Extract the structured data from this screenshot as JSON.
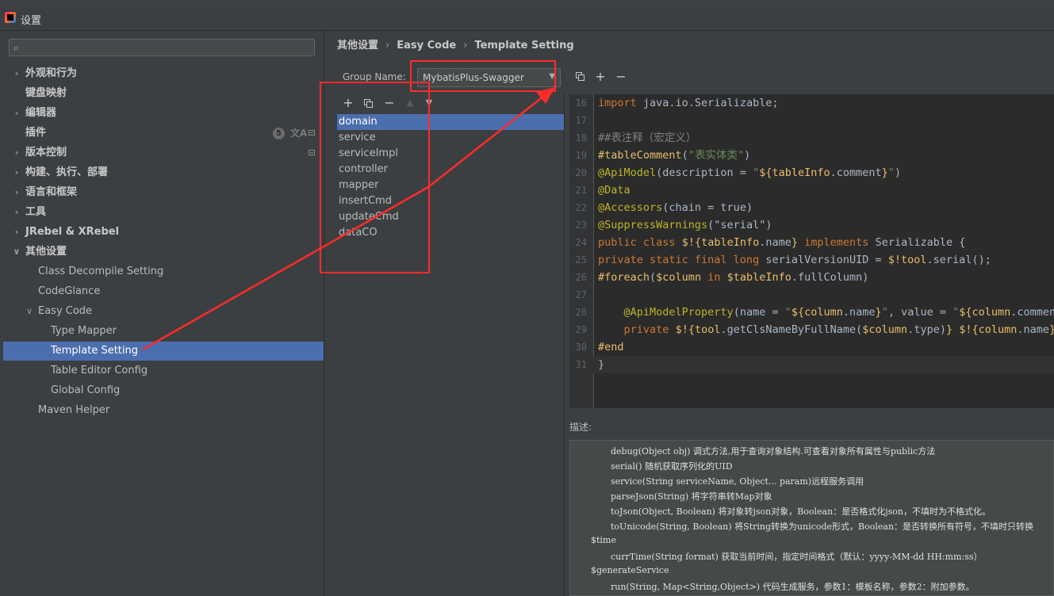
{
  "window": {
    "title": "设置"
  },
  "search": {
    "placeholder": "",
    "value": ""
  },
  "tree": [
    {
      "label": "外观和行为",
      "bold": true,
      "expander": "right"
    },
    {
      "label": "键盘映射",
      "bold": true,
      "expander": "none"
    },
    {
      "label": "编辑器",
      "bold": true,
      "expander": "right"
    },
    {
      "label": "插件",
      "bold": true,
      "expander": "none",
      "badge": "5"
    },
    {
      "label": "版本控制",
      "bold": true,
      "expander": "right"
    },
    {
      "label": "构建、执行、部署",
      "bold": true,
      "expander": "right"
    },
    {
      "label": "语言和框架",
      "bold": true,
      "expander": "right"
    },
    {
      "label": "工具",
      "bold": true,
      "expander": "right"
    },
    {
      "label": "JRebel & XRebel",
      "bold": true,
      "expander": "right"
    },
    {
      "label": "其他设置",
      "bold": true,
      "expander": "down"
    },
    {
      "label": "Class Decompile Setting",
      "bold": false,
      "expander": "none",
      "level": 1
    },
    {
      "label": "CodeGlance",
      "bold": false,
      "expander": "none",
      "level": 1
    },
    {
      "label": "Easy Code",
      "bold": false,
      "expander": "down",
      "level": 1
    },
    {
      "label": "Type Mapper",
      "bold": false,
      "expander": "none",
      "level": 2
    },
    {
      "label": "Template Setting",
      "bold": false,
      "expander": "none",
      "level": 2,
      "selected": true
    },
    {
      "label": "Table Editor Config",
      "bold": false,
      "expander": "none",
      "level": 2
    },
    {
      "label": "Global Config",
      "bold": false,
      "expander": "none",
      "level": 2
    },
    {
      "label": "Maven Helper",
      "bold": false,
      "expander": "none",
      "level": 1
    }
  ],
  "breadcrumb": [
    "其他设置",
    "Easy Code",
    "Template Setting"
  ],
  "group": {
    "label": "Group Name:",
    "value": "MybatisPlus-Swagger"
  },
  "templates": [
    "domain",
    "service",
    "serviceImpl",
    "controller",
    "mapper",
    "insertCmd",
    "updateCmd",
    "dataCO"
  ],
  "selected_template": "domain",
  "code": [
    {
      "n": "16",
      "html": "<span class='kw'>import</span> java.io.Serializable;"
    },
    {
      "n": "17",
      "html": ""
    },
    {
      "n": "18",
      "html": "<span class='cm'>##表注释（宏定义）</span>"
    },
    {
      "n": "19",
      "html": "<span class='vel'>#tableComment</span>(<span class='str'>\"表实体类\"</span>)"
    },
    {
      "n": "20",
      "html": "<span class='ann'>@ApiModel</span>(description = <span class='str'>\"</span><span class='vel'>${tableInfo</span>.comment<span class='vel'>}</span><span class='str'>\"</span>)"
    },
    {
      "n": "21",
      "html": "<span class='ann'>@Data</span>"
    },
    {
      "n": "22",
      "html": "<span class='ann'>@Accessors</span>(chain = true)"
    },
    {
      "n": "23",
      "html": "<span class='ann'>@SuppressWarnings</span>(\"serial\")"
    },
    {
      "n": "24",
      "html": "<span class='kw'>public class</span> <span class='vel'>$!{tableInfo</span>.name<span class='vel'>}</span> <span class='kw'>implements</span> Serializable {"
    },
    {
      "n": "25",
      "html": "<span class='kw'>private static final long</span> serialVersionUID = <span class='vel'>$!tool</span>.serial();"
    },
    {
      "n": "26",
      "html": "<span class='vel'>#foreach</span>(<span class='vel'>$column</span> <span class='kw'>in</span> <span class='vel'>$tableInfo</span>.fullColumn)"
    },
    {
      "n": "27",
      "html": ""
    },
    {
      "n": "28",
      "html": "    <span class='ann'>@ApiModelProperty</span>(name = <span class='str'>\"</span><span class='vel'>${column</span>.name<span class='vel'>}</span><span class='str'>\"</span>, value = <span class='str'>\"</span><span class='vel'>${column</span>.comment"
    },
    {
      "n": "29",
      "html": "    <span class='kw'>private</span> <span class='vel'>$!{tool</span>.getClsNameByFullName(<span class='vel'>$column</span>.type)<span class='vel'>}</span> <span class='vel'>$!{column</span>.name<span class='vel'>}</span>;"
    },
    {
      "n": "30",
      "html": "<span class='vel'>#end</span>"
    },
    {
      "n": "31",
      "html": "}"
    }
  ],
  "description": {
    "label": "描述:",
    "lines": [
      {
        "indent": 1,
        "text": "debug(Object obj) 调式方法,用于查询对象结构.可查看对象所有属性与public方法"
      },
      {
        "indent": 1,
        "text": "serial() 随机获取序列化的UID"
      },
      {
        "indent": 1,
        "text": "service(String serviceName, Object... param)远程服务调用"
      },
      {
        "indent": 1,
        "text": "parseJson(String) 将字符串转Map对象"
      },
      {
        "indent": 1,
        "text": "toJson(Object, Boolean) 将对象转json对象，Boolean：是否格式化json，不填时为不格式化。"
      },
      {
        "indent": 1,
        "text": "toUnicode(String, Boolean) 将String转换为unicode形式，Boolean：是否转换所有符号，不填时只转换"
      },
      {
        "indent": 0,
        "text": "$time"
      },
      {
        "indent": 1,
        "text": "currTime(String format) 获取当前时间，指定时间格式（默认：yyyy-MM-dd HH:mm:ss）"
      },
      {
        "indent": 0,
        "text": "$generateService"
      },
      {
        "indent": 1,
        "text": "run(String, Map<String,Object>) 代码生成服务，参数1：模板名称，参数2：附加参数。"
      }
    ]
  },
  "colors": {
    "selection": "#4b6eaf",
    "annotation_box": "#ff2b2b",
    "background": "#3c3f41",
    "editor": "#2b2b2b"
  }
}
